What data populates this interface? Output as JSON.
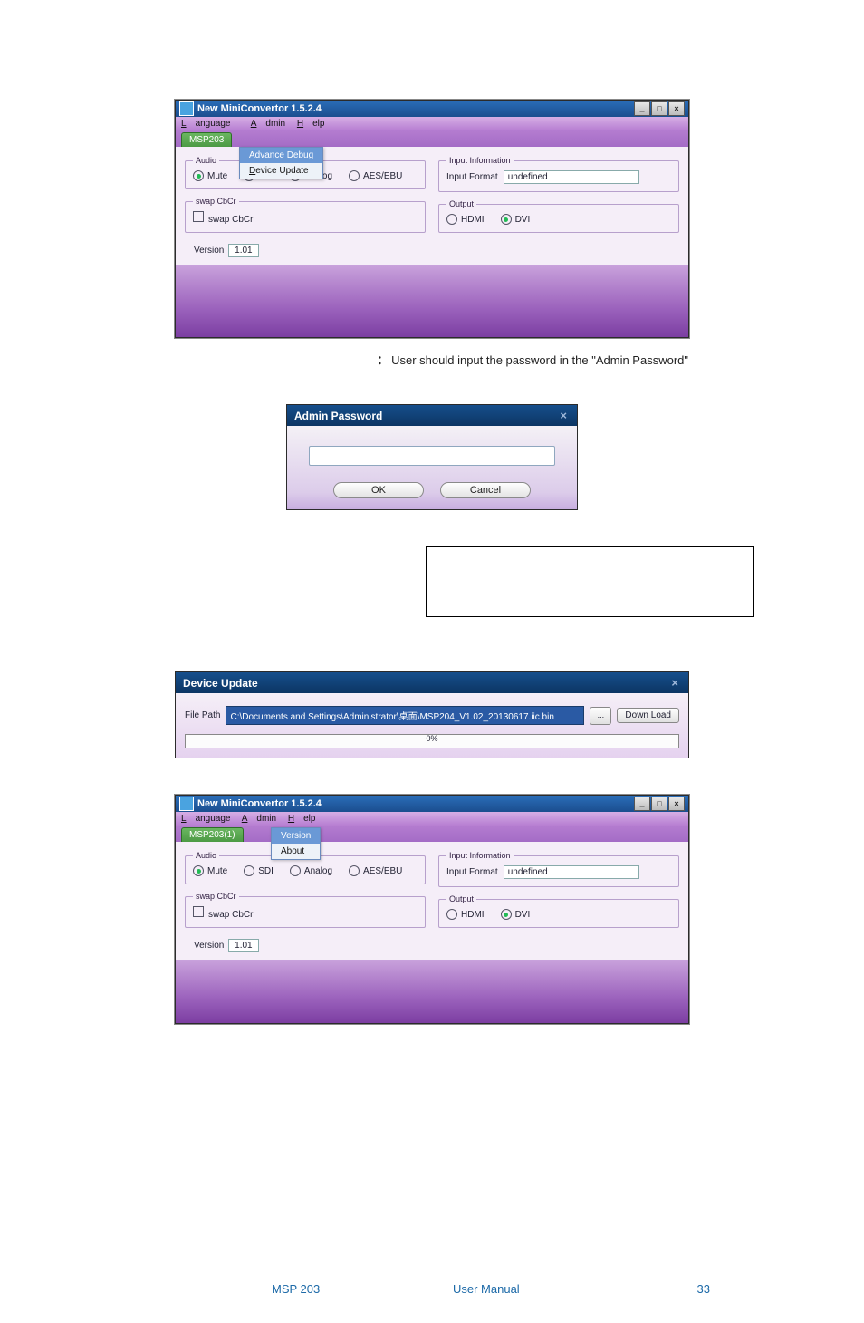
{
  "app_window_1": {
    "title": "New MiniConvertor 1.5.2.4",
    "win_buttons": {
      "min": "_",
      "max": "□",
      "close": "×"
    },
    "menubar": {
      "language": "Language",
      "admin": "Admin",
      "help": "Help"
    },
    "active_tab": "MSP203",
    "dropdown": {
      "parent": "Advance Debug",
      "item": "Device Update"
    },
    "audio": {
      "legend": "Audio",
      "options": {
        "mute": "Mute",
        "sdi": "SDI",
        "analog": "Analog",
        "aesebu": "AES/EBU"
      },
      "selected": "mute"
    },
    "swap": {
      "legend": "swap CbCr",
      "checkbox_label": "swap CbCr"
    },
    "input_info": {
      "legend": "Input Information",
      "label": "Input Format",
      "value": "undefined"
    },
    "output": {
      "legend": "Output",
      "options": {
        "hdmi": "HDMI",
        "dvi": "DVI"
      },
      "selected": "dvi"
    },
    "version": {
      "label": "Version",
      "value": "1.01"
    }
  },
  "admin_caption": "User should input the password in the \"Admin Password\"",
  "admin_dlg": {
    "title": "Admin Password",
    "close": "×",
    "ok": "OK",
    "cancel": "Cancel"
  },
  "device_update": {
    "title": "Device Update",
    "close": "×",
    "file_path_label": "File Path",
    "file_path_value": "C:\\Documents and Settings\\Administrator\\桌面\\MSP204_V1.02_20130617.iic.bin",
    "browse": "...",
    "download": "Down Load",
    "progress": "0%"
  },
  "app_window_2": {
    "title": "New MiniConvertor 1.5.2.4",
    "win_buttons": {
      "min": "_",
      "max": "□",
      "close": "×"
    },
    "menubar": {
      "language": "Language",
      "admin": "Admin",
      "help": "Help"
    },
    "active_tab": "MSP203(1)",
    "dropdown": {
      "version": "Version",
      "about": "About"
    },
    "audio": {
      "legend": "Audio",
      "options": {
        "mute": "Mute",
        "sdi": "SDI",
        "analog": "Analog",
        "aesebu": "AES/EBU"
      },
      "selected": "mute"
    },
    "swap": {
      "legend": "swap CbCr",
      "checkbox_label": "swap CbCr"
    },
    "input_info": {
      "legend": "Input Information",
      "label": "Input Format",
      "value": "undefined"
    },
    "output": {
      "legend": "Output",
      "options": {
        "hdmi": "HDMI",
        "dvi": "DVI"
      },
      "selected": "dvi"
    },
    "version": {
      "label": "Version",
      "value": "1.01"
    }
  },
  "footer": {
    "left": "MSP 203",
    "center": "User Manual",
    "right": "33"
  }
}
